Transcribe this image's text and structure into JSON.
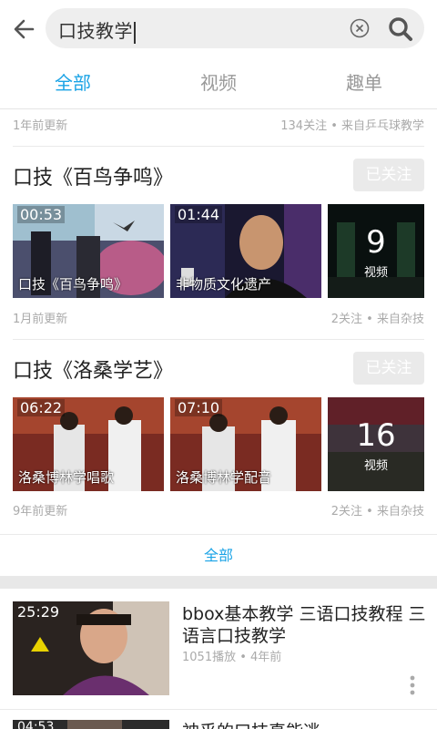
{
  "search": {
    "query": "口技教学"
  },
  "tabs": [
    {
      "label": "全部"
    },
    {
      "label": "视频"
    },
    {
      "label": "趣单"
    }
  ],
  "top_meta": {
    "left": "1年前更新",
    "right": "134关注 • 来自乒乓球教学"
  },
  "groups": [
    {
      "title": "口技《百鸟争鸣》",
      "follow_label": "已关注",
      "videos": [
        {
          "duration": "00:53",
          "caption": "口技《百鸟争鸣》"
        },
        {
          "duration": "01:44",
          "caption": "非物质文化遗产"
        }
      ],
      "count": {
        "value": "9",
        "label": "视频"
      },
      "meta_left": "1月前更新",
      "meta_right": "2关注 • 来自杂技"
    },
    {
      "title": "口技《洛桑学艺》",
      "follow_label": "已关注",
      "videos": [
        {
          "duration": "06:22",
          "caption": "洛桑博林学唱歌"
        },
        {
          "duration": "07:10",
          "caption": "洛桑博林学配音"
        }
      ],
      "count": {
        "value": "16",
        "label": "视频"
      },
      "meta_left": "9年前更新",
      "meta_right": "2关注 • 来自杂技"
    }
  ],
  "all_link": "全部",
  "video_list": [
    {
      "duration": "25:29",
      "title": "bbox基本教学 三语口技教程 三语言口技教学",
      "meta": "1051播放 • 4年前"
    },
    {
      "duration": "04:53",
      "title": "神乎的口技真能逃"
    }
  ]
}
